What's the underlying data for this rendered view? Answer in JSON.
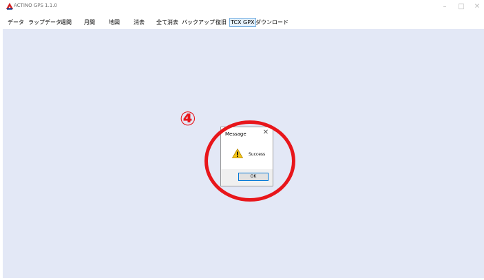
{
  "window": {
    "title": "ACTINO GPS 1.1.0",
    "icons": {
      "app": "app-logo-icon",
      "minimize": "minimize-icon",
      "maximize": "maximize-icon",
      "close": "close-icon"
    }
  },
  "menu": {
    "items": [
      {
        "label": "データ",
        "selected": false
      },
      {
        "label": "ラップデータ",
        "selected": false
      },
      {
        "label": "週間",
        "selected": false
      },
      {
        "label": "月間",
        "selected": false
      },
      {
        "label": "地図",
        "selected": false
      },
      {
        "label": "消去",
        "selected": false
      },
      {
        "label": "全て消去",
        "selected": false
      },
      {
        "label": "バックアップ",
        "selected": false
      },
      {
        "label": "復旧",
        "selected": false
      },
      {
        "label": "TCX GPX",
        "selected": true
      },
      {
        "label": "ダウンロード",
        "selected": false
      }
    ]
  },
  "dialog": {
    "title": "Message",
    "close_glyph": "✕",
    "icon": "warning-icon",
    "message": "Success",
    "ok_label": "OK"
  },
  "annotation": {
    "step": "④",
    "color": "#e8161b"
  },
  "colors": {
    "client_bg": "#e3e8f6",
    "menu_selected_bg": "#e5f1fb",
    "menu_selected_border": "#7ab2e3"
  }
}
